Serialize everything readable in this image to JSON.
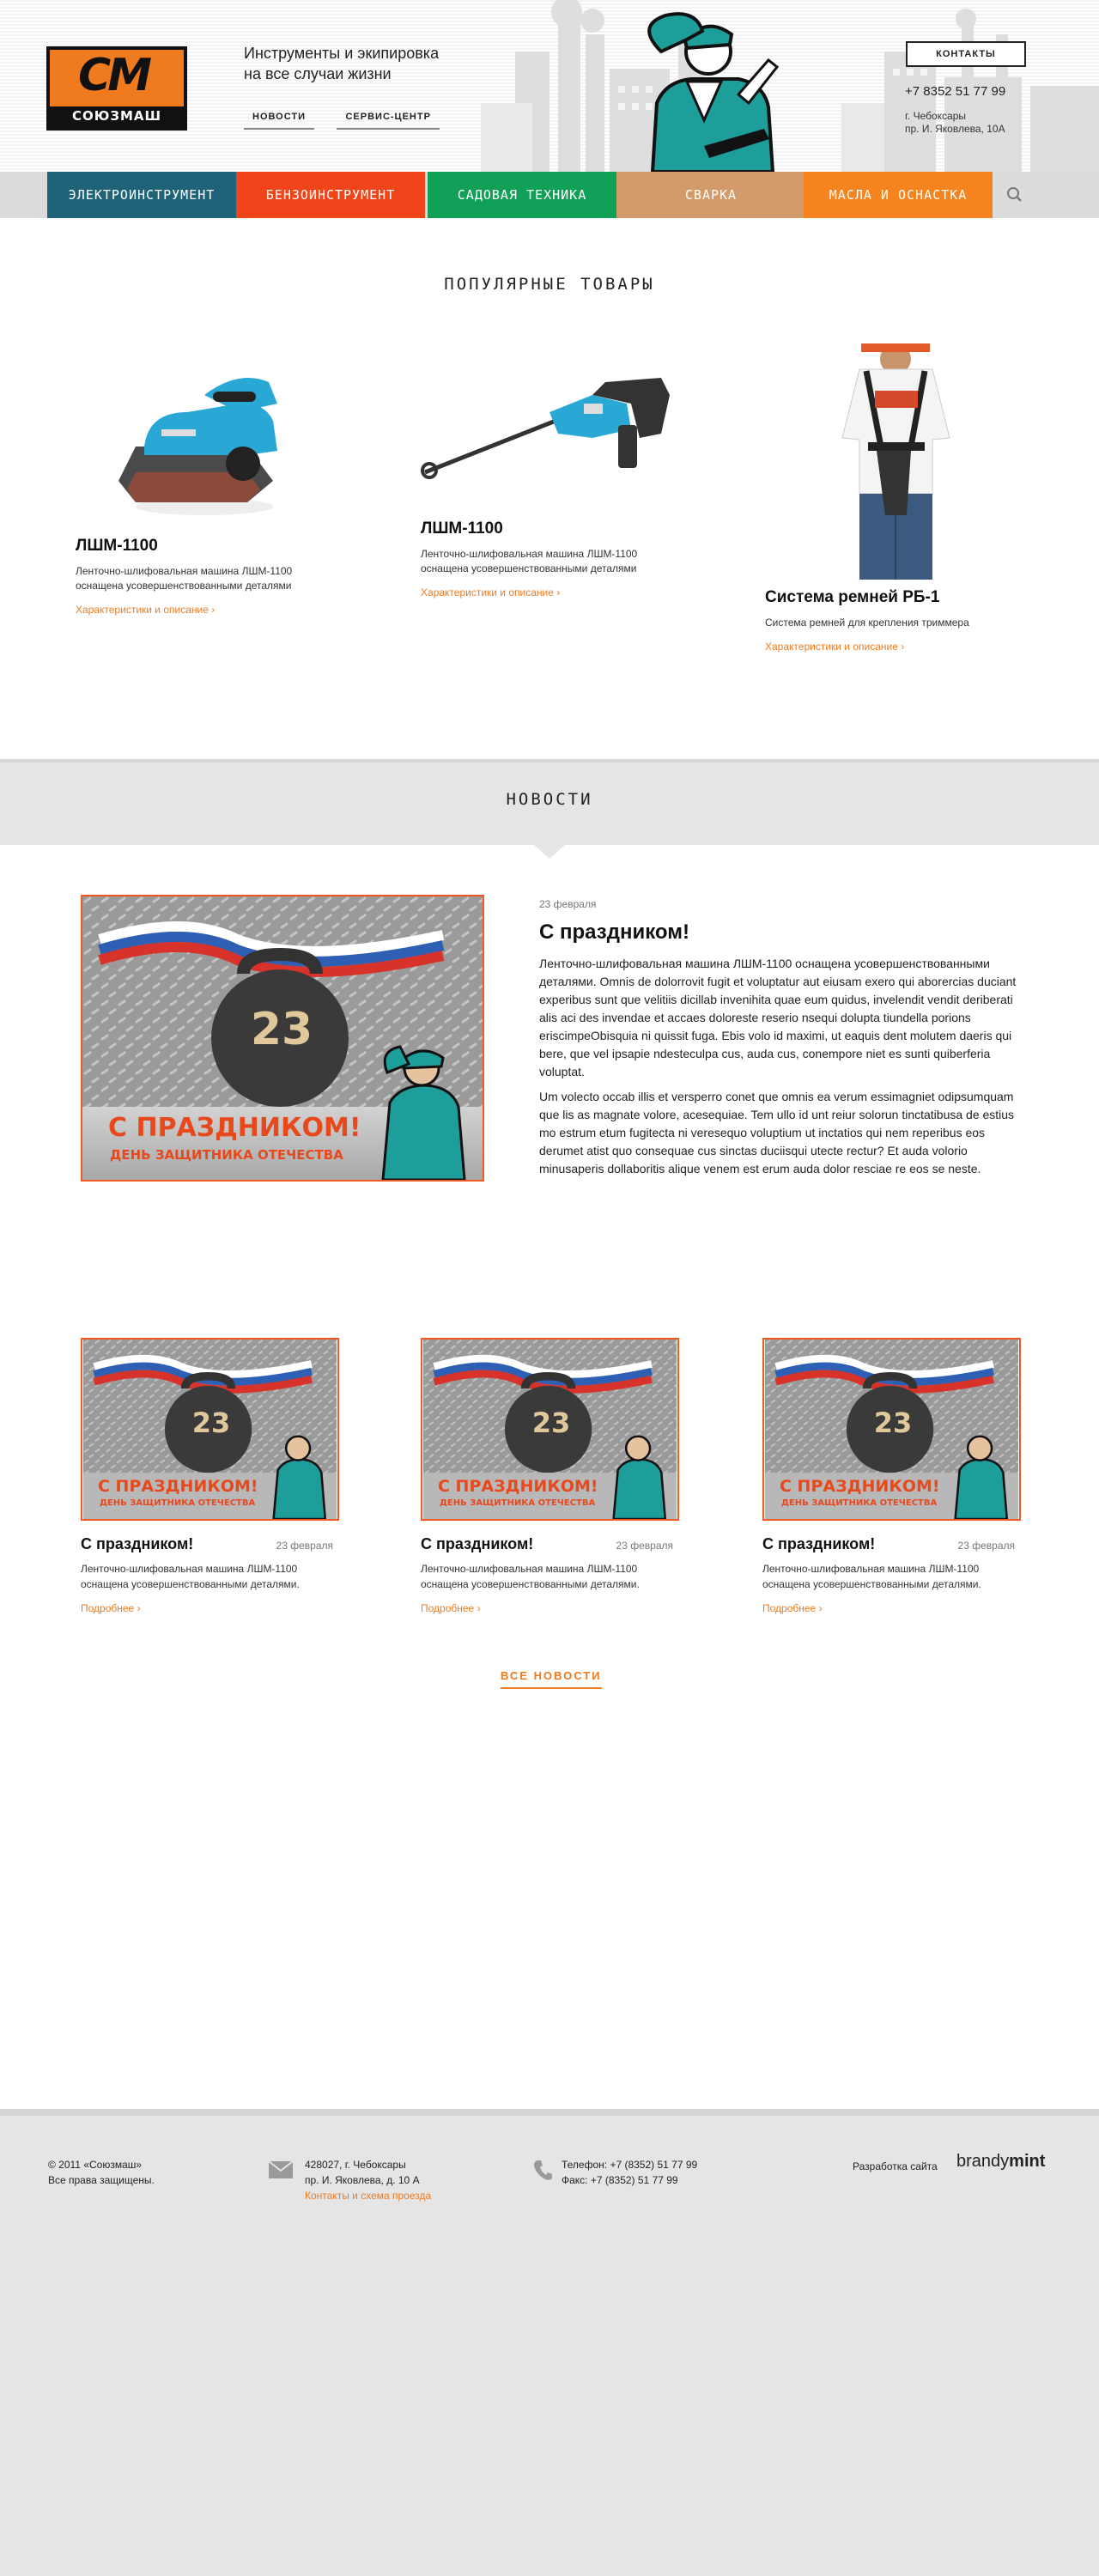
{
  "brand": {
    "logo_mark": "СМ",
    "name": "СОЮЗМАШ",
    "accent": "#f07b1f"
  },
  "header": {
    "tagline_line1": "Инструменты и экипировка",
    "tagline_line2": "на все случаи жизни",
    "nav": [
      {
        "label": "Новости"
      },
      {
        "label": "Сервис-центр"
      }
    ],
    "contacts_label": "Контакты",
    "phone": "+7 8352 51 77 99",
    "city": "г. Чебоксары",
    "street": "пр. И. Яковлева, 10А"
  },
  "main_nav": [
    {
      "label": "Электроинструмент",
      "color": "#1f6379"
    },
    {
      "label": "Бензоинструмент",
      "color": "#f0441a"
    },
    {
      "label": "Садовая техника",
      "color": "#11a057"
    },
    {
      "label": "Сварка",
      "color": "#d49b6a"
    },
    {
      "label": "Масла и оснастка",
      "color": "#f5841f"
    }
  ],
  "search_icon": "search-icon",
  "popular": {
    "title": "Популярные товары",
    "products": [
      {
        "name": "ЛШМ-1100",
        "desc": "Ленточно-шлифовальная машина ЛШМ-1100 оснащена усовершенствованными деталями",
        "link": "Характеристики и описание ›"
      },
      {
        "name": "ЛШМ-1100",
        "desc": "Ленточно-шлифовальная машина ЛШМ-1100 оснащена усовершенствованными деталями",
        "link": "Характеристики и описание ›"
      },
      {
        "name": "Система ремней РБ-1",
        "desc": "Система ремней для крепления триммера",
        "link": "Характеристики и описание ›"
      }
    ]
  },
  "news": {
    "title": "Новости",
    "featured": {
      "date": "23 февраля",
      "title": "С праздником!",
      "p1": "Ленточно-шлифовальная машина ЛШМ-1100 оснащена усовершенствованными деталями. Omnis de dolorrovit fugit et voluptatur aut eiusam exero qui aborercias duciant experibus sunt que velitiis dicillab invenihita quae eum quidus, invelendit vendit deriberati alis aci des invendae et accaes doloreste reserio nsequi dolupta tiundella porions eriscimpeObisquia ni quissit fuga. Ebis volo id maximi, ut eaquis dent molutem daeris qui bere, que vel ipsapie ndesteculpa cus, auda cus, conempore niet es sunti quiberferia voluptat.",
      "p2": "Um volecto occab illis et versperro conet que omnis ea verum essimagniet odipsumquam que lis as magnate volore, acesequiae. Tem ullo id unt reiur solorun tinctatibusa de estius mo estrum etum fugitecta ni veresequo voluptium ut inctatios qui nem reperibus eos derumet atist quo consequae cus sinctas duciisqui utecte rectur? Et auda volorio minusaperis dollaboritis alique venem est erum auda dolor resciae re eos se neste."
    },
    "banner": {
      "number": "23",
      "headline": "С ПРАЗДНИКОМ!",
      "sub": "ДЕНЬ ЗАЩИТНИКА ОТЕЧЕСТВА"
    },
    "cards": [
      {
        "title": "С праздником!",
        "date": "23 февраля",
        "text": "Ленточно-шлифовальная машина ЛШМ-1100 оснащена усовершенствованными деталями.",
        "more": "Подробнее ›"
      },
      {
        "title": "С праздником!",
        "date": "23 февраля",
        "text": "Ленточно-шлифовальная машина ЛШМ-1100 оснащена усовершенствованными деталями.",
        "more": "Подробнее ›"
      },
      {
        "title": "С праздником!",
        "date": "23 февраля",
        "text": "Ленточно-шлифовальная машина ЛШМ-1100 оснащена усовершенствованными деталями.",
        "more": "Подробнее ›"
      }
    ],
    "all_label": "Все новости"
  },
  "footer": {
    "copyright": "© 2011 «Союзмаш»",
    "rights": "Все права защищены.",
    "address1": "428027, г. Чебоксары",
    "address2": "пр. И. Яковлева, д. 10 А",
    "map_link": "Контакты и схема проезда",
    "tel": "Телефон: +7 (8352) 51 77 99",
    "fax": "Факс: +7 (8352) 51 77 99",
    "dev_label": "Разработка сайта",
    "dev_logo_a": "brandy",
    "dev_logo_b": "mint"
  }
}
